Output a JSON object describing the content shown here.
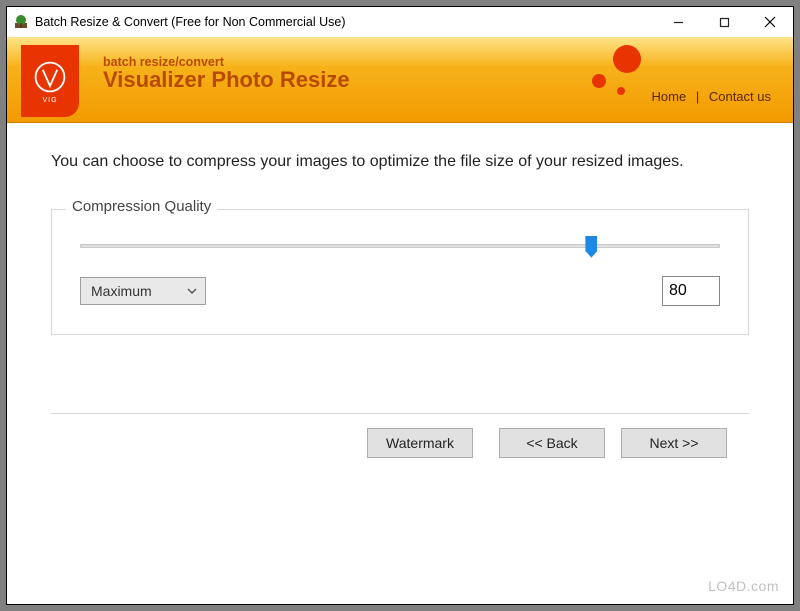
{
  "window": {
    "title": "Batch Resize & Convert (Free for Non Commercial Use)"
  },
  "header": {
    "tagline": "batch resize/convert",
    "appname": "Visualizer Photo Resize",
    "logo_text": "VIG",
    "links": {
      "home": "Home",
      "contact": "Contact us"
    }
  },
  "main": {
    "instruction": "You can choose to compress your images to optimize the file size of your resized images.",
    "fieldset_legend": "Compression Quality",
    "slider_percent": 80,
    "quality_select": "Maximum",
    "quality_value": "80"
  },
  "buttons": {
    "watermark": "Watermark",
    "back": "<< Back",
    "next": "Next >>"
  },
  "watermark_site": "LO4D.com"
}
